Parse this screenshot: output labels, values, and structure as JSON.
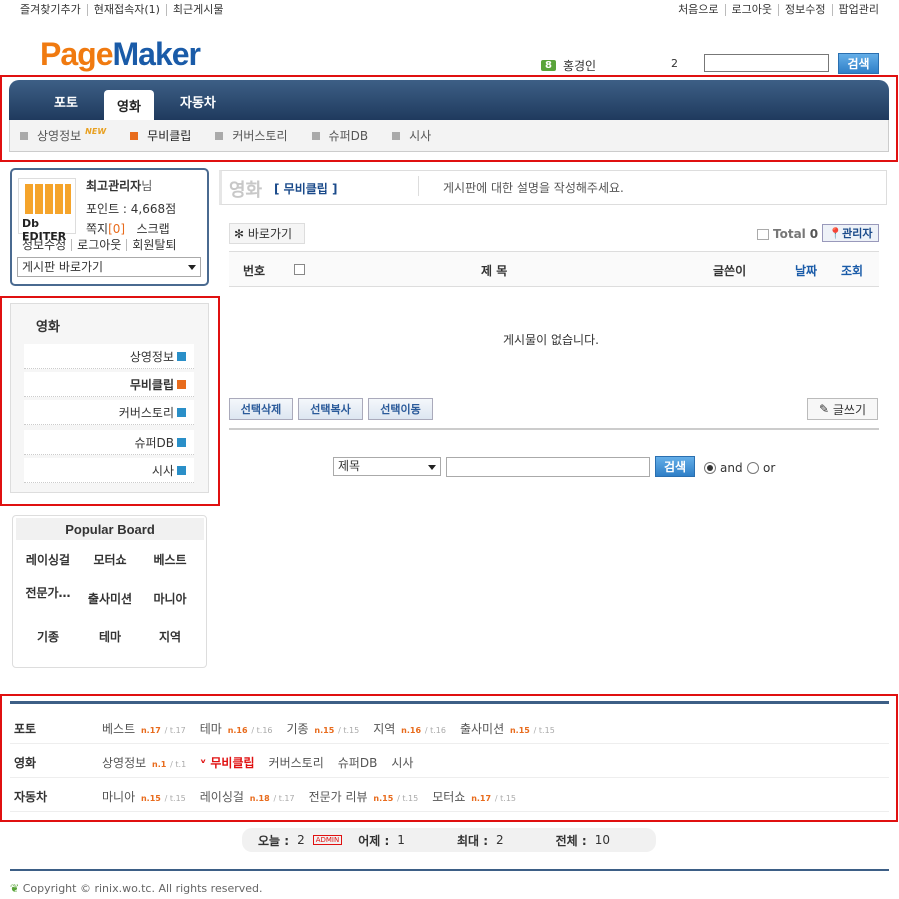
{
  "top_links_left": [
    "즐겨찾기추가",
    "현재접속자(1)",
    "최근게시물"
  ],
  "top_links_right": [
    "처음으로",
    "로그아웃",
    "정보수정",
    "팝업관리"
  ],
  "logo": {
    "p": "Page",
    "m": "Maker"
  },
  "online": {
    "count": "8",
    "name": "홍경인",
    "num": "2"
  },
  "search": {
    "button": "검색"
  },
  "nav": {
    "tabs": [
      "포토",
      "영화",
      "자동차"
    ],
    "sub": [
      "상영정보",
      "무비클립",
      "커버스토리",
      "슈퍼DB",
      "시사"
    ],
    "new_badge": "NEW"
  },
  "login": {
    "logo_text": "Db EDITER",
    "name": "최고관리자",
    "name_suffix": "님",
    "point": "포인트 : 4,668점",
    "memo_label": "쪽지",
    "memo_count": "[0]",
    "scrap": "스크랩",
    "links": [
      "정보수정",
      "로그아웃",
      "회원탈퇴"
    ],
    "select": "게시판 바로가기"
  },
  "side_menu": {
    "title": "영화",
    "items": [
      "상영정보",
      "무비클립",
      "커버스토리",
      "슈퍼DB",
      "시사"
    ]
  },
  "popular": {
    "title": "Popular Board",
    "items": [
      "레이싱걸",
      "모터쇼",
      "베스트",
      "전문가…",
      "출사미션",
      "마니아",
      "기종",
      "테마",
      "지역"
    ]
  },
  "board": {
    "title": "영화",
    "sub": "[ 무비클립 ]",
    "desc": "게시판에 대한 설명을 작성해주세요.",
    "shortcut": "✻ 바로가기",
    "total_label": "Total",
    "total_value": "0",
    "admin": "관리자",
    "columns": {
      "no": "번호",
      "subject": "제  목",
      "writer": "글쓴이",
      "date": "날짜",
      "hit": "조회"
    },
    "empty": "게시물이 없습니다.",
    "actions": [
      "선택삭제",
      "선택복사",
      "선택이동"
    ],
    "write": "글쓰기",
    "search_select": "제목",
    "search_button": "검색",
    "radio_and": "and",
    "radio_or": "or"
  },
  "sitemap": {
    "rows": [
      {
        "cat": "포토",
        "items": [
          {
            "label": "베스트",
            "n": "n.17",
            "t": "t.17"
          },
          {
            "label": "테마",
            "n": "n.16",
            "t": "t.16"
          },
          {
            "label": "기종",
            "n": "n.15",
            "t": "t.15"
          },
          {
            "label": "지역",
            "n": "n.16",
            "t": "t.16"
          },
          {
            "label": "출사미션",
            "n": "n.15",
            "t": "t.15"
          }
        ]
      },
      {
        "cat": "영화",
        "items": [
          {
            "label": "상영정보",
            "n": "n.1",
            "t": "t.1"
          },
          {
            "label": "무비클립",
            "n": "",
            "t": ""
          },
          {
            "label": "커버스토리",
            "n": "",
            "t": ""
          },
          {
            "label": "슈퍼DB",
            "n": "",
            "t": ""
          },
          {
            "label": "시사",
            "n": "",
            "t": ""
          }
        ]
      },
      {
        "cat": "자동차",
        "items": [
          {
            "label": "마니아",
            "n": "n.15",
            "t": "t.15"
          },
          {
            "label": "레이싱걸",
            "n": "n.18",
            "t": "t.17"
          },
          {
            "label": "전문가 리뷰",
            "n": "n.15",
            "t": "t.15"
          },
          {
            "label": "모터쇼",
            "n": "n.17",
            "t": "t.15"
          }
        ]
      }
    ]
  },
  "stats": {
    "today_label": "오늘 :",
    "today": "2",
    "admin": "ADMIN",
    "yesterday_label": "어제 :",
    "yesterday": "1",
    "max_label": "최대 :",
    "max": "2",
    "total_label": "전체 :",
    "total": "10"
  },
  "copyright": "Copyright © rinix.wo.tc. All rights reserved."
}
